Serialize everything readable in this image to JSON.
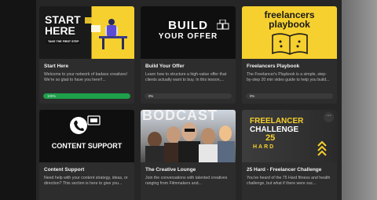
{
  "cards": [
    {
      "thumb_text": [
        "START",
        "HERE"
      ],
      "thumb_sub": "TAKE THE FIRST STEP",
      "title": "Start Here",
      "desc": "Welcome to your network of badass creatives! We're so glad to have you here!!...",
      "progress_label": "100%",
      "progress": 1.0,
      "accent": "#1ea04a"
    },
    {
      "thumb_text": [
        "BUILD",
        "YOUR OFFER"
      ],
      "title": "Build Your Offer",
      "desc": "Learn how to structure a high-value offer that clients actually want to buy. In this lesson,...",
      "progress_label": "0%",
      "progress": 0
    },
    {
      "thumb_text": [
        "freelancers",
        "playbook"
      ],
      "title": "Freelancers Playbook",
      "desc": "The Freelancer's Playbook is a simple, step-by-step 20 min video guide to help you build...",
      "progress_label": "0%",
      "progress": 0
    },
    {
      "thumb_text": [
        "CONTENT SUPPORT"
      ],
      "title": "Content Support",
      "desc": "Need help with your content strategy, ideas, or direction? This section is here to give you...",
      "progress_label": "0%",
      "progress": 0
    },
    {
      "thumb_text": [
        "BOD",
        "CAST"
      ],
      "title": "The Creative Lounge",
      "desc": "Join the conversations with talented creatives ranging from Filmmakers and...",
      "progress_label": "0%",
      "progress": 0
    },
    {
      "thumb_text": [
        "FREELANCER",
        "CHALLENGE",
        "25",
        "HARD"
      ],
      "title": "25 Hard - Freelancer Challenge",
      "desc": "You've heard of the 75 Hard fitness and health challenge, but what if there were suc...",
      "progress_label": "0%",
      "progress": 0,
      "menu_icon": "more-dots-icon"
    }
  ],
  "colors": {
    "panel": "#262626",
    "card": "#2d2d2d",
    "yellow": "#f6d02e",
    "progress_green": "#1ea04a"
  }
}
